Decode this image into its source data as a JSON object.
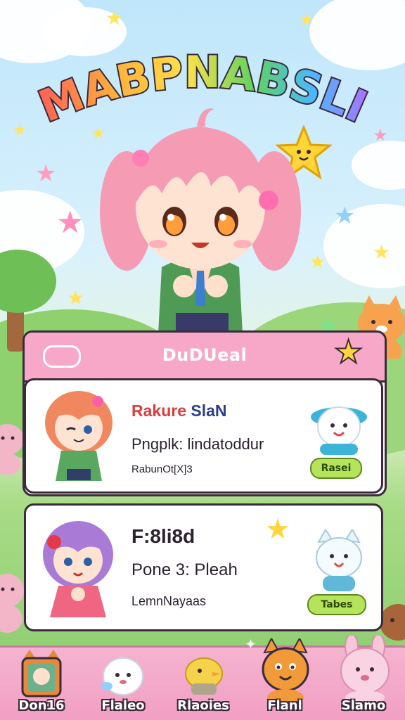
{
  "game": {
    "title": "MABPNABSLI"
  },
  "dialog": {
    "title": "DuDUeal"
  },
  "cards": [
    {
      "name_part1": "Rakure",
      "name_part2": "SlaN",
      "line2": "Pngplk: lindatoddur",
      "line3": "RabunOt[X]3",
      "button_label": "Rasei"
    },
    {
      "name_part1": "F:8li8d",
      "line2": "Pone 3: Pleah",
      "line3": "LemnNayaas",
      "button_label": "Tabes"
    }
  ],
  "nav": [
    {
      "label": "Don16",
      "icon": "fox-portrait-icon"
    },
    {
      "label": "Flaleo",
      "icon": "bunny-icon"
    },
    {
      "label": "Rlaoies",
      "icon": "bird-icon"
    },
    {
      "label": "Flanl",
      "icon": "orange-cat-icon"
    },
    {
      "label": "Slamo",
      "icon": "pink-bunny-icon"
    }
  ],
  "colors": {
    "header_pink": "#f7a8c9",
    "outline": "#3a2a3a",
    "button_green": "#b5e35a",
    "title_gradient": [
      "#ff5a5a",
      "#ffb13b",
      "#ffe14a",
      "#5ed35e",
      "#4ab8ff",
      "#b36bff"
    ]
  }
}
